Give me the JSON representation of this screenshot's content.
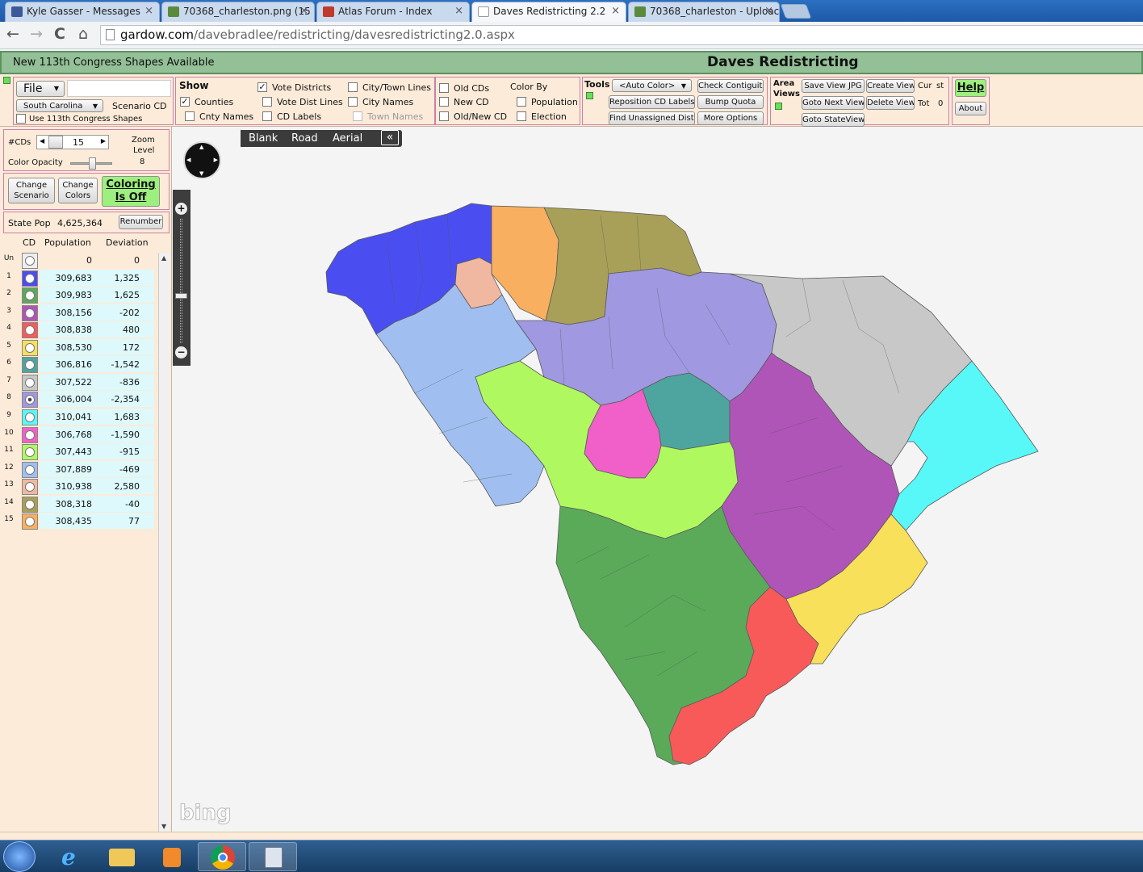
{
  "browser": {
    "tabs": [
      {
        "label": "Kyle Gasser - Messages",
        "icon": "facebook-icon",
        "color": "#3b5998"
      },
      {
        "label": "70368_charleston.png (15",
        "icon": "image-icon",
        "color": "#5b8a3c"
      },
      {
        "label": "Atlas Forum - Index",
        "icon": "flag-icon",
        "color": "#c0392b"
      },
      {
        "label": "Daves Redistricting 2.2",
        "icon": "page-icon",
        "color": "#ffffff"
      },
      {
        "label": "70368_charleston - Uploac",
        "icon": "image-icon",
        "color": "#5b8a3c"
      }
    ],
    "url_prefix": "gardow.com",
    "url_path": "/davebradlee/redistricting/davesredistricting2.0.aspx",
    "nav": {
      "back": "←",
      "forward": "→",
      "reload": "C",
      "home": "⌂"
    }
  },
  "header": {
    "message": "New 113th Congress Shapes Available",
    "title": "Daves Redistricting",
    "toggle": "−"
  },
  "file": {
    "label": "File",
    "state": "South Carolina",
    "scenario": "Scenario CD",
    "use113": "Use 113th Congress Shapes"
  },
  "show": {
    "title": "Show",
    "items": [
      {
        "label": "Vote Districts",
        "checked": true
      },
      {
        "label": "City/Town Lines",
        "checked": false
      },
      {
        "label": "Counties",
        "checked": true
      },
      {
        "label": "Vote Dist Lines",
        "checked": false
      },
      {
        "label": "City Names",
        "checked": false
      },
      {
        "label": "Cnty Names",
        "checked": false
      },
      {
        "label": "CD Labels",
        "checked": false
      },
      {
        "label": "Town Names",
        "checked": false
      }
    ]
  },
  "cds": {
    "old": "Old CDs",
    "new": "New CD",
    "oldnew": "Old/New CD",
    "colorby": "Color By",
    "population": "Population",
    "election": "Election"
  },
  "tools": {
    "title": "Tools",
    "auto_color": "<Auto Color>",
    "reposition": "Reposition CD Labels",
    "find_unassigned": "Find Unassigned Dists",
    "check_contiguity": "Check Contiguity",
    "bump_quota": "Bump Quota",
    "more_options": "More Options"
  },
  "views": {
    "title1": "Area",
    "title2": "Views",
    "save_jpg": "Save View JPG",
    "create_view": "Create View",
    "goto_next": "Goto Next View",
    "delete_view": "Delete View",
    "goto_state": "Goto StateView",
    "cur_label": "Cur",
    "cur_value": "st",
    "tot_label": "Tot",
    "tot_value": "0"
  },
  "help": {
    "help": "Help",
    "about": "About"
  },
  "side": {
    "num_cds_label": "#CDs",
    "num_cds": "15",
    "zoom_label1": "Zoom",
    "zoom_label2": "Level",
    "zoom_level": "8",
    "opacity_label": "Color Opacity",
    "change_scenario1": "Change",
    "change_scenario2": "Scenario",
    "change_colors1": "Change",
    "change_colors2": "Colors",
    "coloring1": "Coloring",
    "coloring2": "Is Off",
    "state_pop_label": "State Pop",
    "state_pop": "4,625,364",
    "renumber": "Renumber",
    "col_cd": "CD",
    "col_pop": "Population",
    "col_dev": "Deviation"
  },
  "districts": [
    {
      "cd": "Un",
      "color": "#eeeeee",
      "population": "0",
      "deviation": "0"
    },
    {
      "cd": "1",
      "color": "#4a4ef0",
      "population": "309,683",
      "deviation": "1,325"
    },
    {
      "cd": "2",
      "color": "#5aaa5a",
      "population": "309,983",
      "deviation": "1,625"
    },
    {
      "cd": "3",
      "color": "#b055b8",
      "population": "308,156",
      "deviation": "-202"
    },
    {
      "cd": "4",
      "color": "#f85a5a",
      "population": "308,838",
      "deviation": "480"
    },
    {
      "cd": "5",
      "color": "#f8e05a",
      "population": "308,530",
      "deviation": "172"
    },
    {
      "cd": "6",
      "color": "#4ea5a0",
      "population": "306,816",
      "deviation": "-1,542"
    },
    {
      "cd": "7",
      "color": "#c8c8c8",
      "population": "307,522",
      "deviation": "-836"
    },
    {
      "cd": "8",
      "color": "#a098e0",
      "population": "306,004",
      "deviation": "-2,354"
    },
    {
      "cd": "9",
      "color": "#58f8f8",
      "population": "310,041",
      "deviation": "1,683"
    },
    {
      "cd": "10",
      "color": "#f060c8",
      "population": "306,768",
      "deviation": "-1,590"
    },
    {
      "cd": "11",
      "color": "#b0f860",
      "population": "307,443",
      "deviation": "-915"
    },
    {
      "cd": "12",
      "color": "#a0bff0",
      "population": "307,889",
      "deviation": "-469"
    },
    {
      "cd": "13",
      "color": "#f0b8a0",
      "population": "310,938",
      "deviation": "2,580"
    },
    {
      "cd": "14",
      "color": "#a8a058",
      "population": "308,318",
      "deviation": "-40"
    },
    {
      "cd": "15",
      "color": "#f8b060",
      "population": "308,435",
      "deviation": "77"
    }
  ],
  "map": {
    "tabs": [
      "Blank",
      "Road",
      "Aerial"
    ],
    "collapse": "«",
    "attribution": "bing"
  }
}
